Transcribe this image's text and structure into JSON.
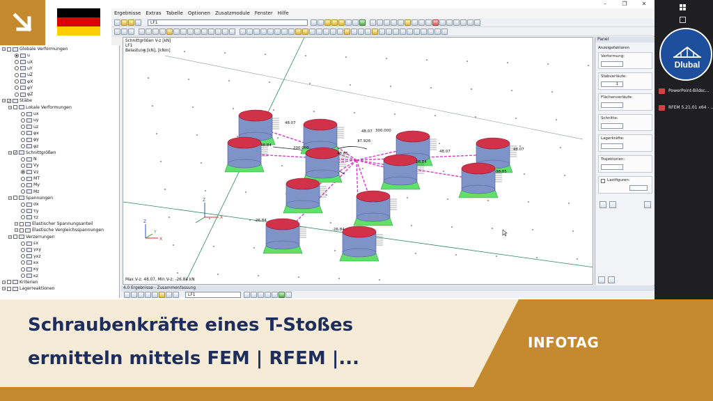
{
  "window": {
    "menu": [
      "Ergebnisse",
      "Extras",
      "Tabelle",
      "Optionen",
      "Zusatzmodule",
      "Fenster",
      "Hilfe"
    ],
    "loadcase": "LF1"
  },
  "navigator": {
    "items": [
      {
        "label": "Globale Verformungen",
        "level": 0,
        "kind": "group"
      },
      {
        "label": "u",
        "level": 2,
        "kind": "radio",
        "on": true
      },
      {
        "label": "uX",
        "level": 2,
        "kind": "radio"
      },
      {
        "label": "uY",
        "level": 2,
        "kind": "radio"
      },
      {
        "label": "uZ",
        "level": 2,
        "kind": "radio"
      },
      {
        "label": "φX",
        "level": 2,
        "kind": "radio"
      },
      {
        "label": "φY",
        "level": 2,
        "kind": "radio"
      },
      {
        "label": "φZ",
        "level": 2,
        "kind": "radio"
      },
      {
        "label": "Stäbe",
        "level": 0,
        "kind": "group",
        "on": true
      },
      {
        "label": "Lokale Verformungen",
        "level": 1,
        "kind": "group"
      },
      {
        "label": "ux",
        "level": 3,
        "kind": "radio"
      },
      {
        "label": "uy",
        "level": 3,
        "kind": "radio"
      },
      {
        "label": "uz",
        "level": 3,
        "kind": "radio"
      },
      {
        "label": "φx",
        "level": 3,
        "kind": "radio"
      },
      {
        "label": "φy",
        "level": 3,
        "kind": "radio"
      },
      {
        "label": "φz",
        "level": 3,
        "kind": "radio"
      },
      {
        "label": "Schnittgrößen",
        "level": 1,
        "kind": "group",
        "on": true
      },
      {
        "label": "N",
        "level": 3,
        "kind": "radio"
      },
      {
        "label": "Vy",
        "level": 3,
        "kind": "radio"
      },
      {
        "label": "Vz",
        "level": 3,
        "kind": "radio",
        "on": true
      },
      {
        "label": "MT",
        "level": 3,
        "kind": "radio"
      },
      {
        "label": "My",
        "level": 3,
        "kind": "radio"
      },
      {
        "label": "Mz",
        "level": 3,
        "kind": "radio"
      },
      {
        "label": "Spannungen",
        "level": 1,
        "kind": "group"
      },
      {
        "label": "σx",
        "level": 3,
        "kind": "radio"
      },
      {
        "label": "τy",
        "level": 3,
        "kind": "radio"
      },
      {
        "label": "τz",
        "level": 3,
        "kind": "radio"
      },
      {
        "label": "Elastischer Spannungsanteil",
        "level": 2,
        "kind": "group"
      },
      {
        "label": "Elastische Vergleichsspannungen",
        "level": 2,
        "kind": "group"
      },
      {
        "label": "Verzerrungen",
        "level": 1,
        "kind": "group"
      },
      {
        "label": "εx",
        "level": 3,
        "kind": "radio"
      },
      {
        "label": "γxy",
        "level": 3,
        "kind": "radio"
      },
      {
        "label": "γxz",
        "level": 3,
        "kind": "radio"
      },
      {
        "label": "κx",
        "level": 3,
        "kind": "radio"
      },
      {
        "label": "κy",
        "level": 3,
        "kind": "radio"
      },
      {
        "label": "κz",
        "level": 3,
        "kind": "radio"
      },
      {
        "label": "Kriterien",
        "level": 0,
        "kind": "group"
      },
      {
        "label": "Lagerreaktionen",
        "level": 0,
        "kind": "group"
      }
    ]
  },
  "viewport": {
    "info_title": "Schnittgrößen V-z [kN]",
    "info_lc": "LF1",
    "info_load": "Belastung [kN], [kNm]",
    "status": "Max V-z: 48.07, Min V-z: -26.84 kN",
    "values": [
      "48.07",
      "48.07",
      "48.84",
      "48.07",
      "48.07",
      "48.85",
      "38.85",
      "26.84",
      "-26.84",
      "-26.84",
      "-26.84",
      "300.000",
      "37.926",
      "200.000"
    ],
    "axes": [
      "Z",
      "X",
      "Y"
    ]
  },
  "panel": {
    "title": "Panel",
    "section": "Anzeigefaktoren",
    "labels": [
      "Verformung:",
      "Stabverläufe:",
      "Flächenverläufe:",
      "Schnitte:",
      "Lagerkräfte:",
      "Trajektorien:",
      "Lastfiguren:"
    ],
    "stab_value": "1"
  },
  "results": {
    "title": "4.0 Ergebnisse - Zusammenfassung",
    "loadcase": "LF1"
  },
  "taskbar": {
    "items": [
      "PowerPoint-Bildsc...",
      "RFEM 5.21.01 x64 - ..."
    ],
    "logo": "Dlubal"
  },
  "banner": {
    "title_line1": "Schraubenkräfte eines T-Stoßes",
    "title_line2": "ermitteln mittels FEM | RFEM |...",
    "tag": "INFOTAG"
  },
  "colors": {
    "accent": "#c58a2e",
    "title": "#1e2e5c",
    "banner_bg": "#f5ebd7",
    "logo_bg": "#1d4f9c",
    "bolt_head": "#d1324a",
    "bolt_body": "#7f93c9",
    "plate": "#5ee06a",
    "member": "#d63cc8"
  }
}
